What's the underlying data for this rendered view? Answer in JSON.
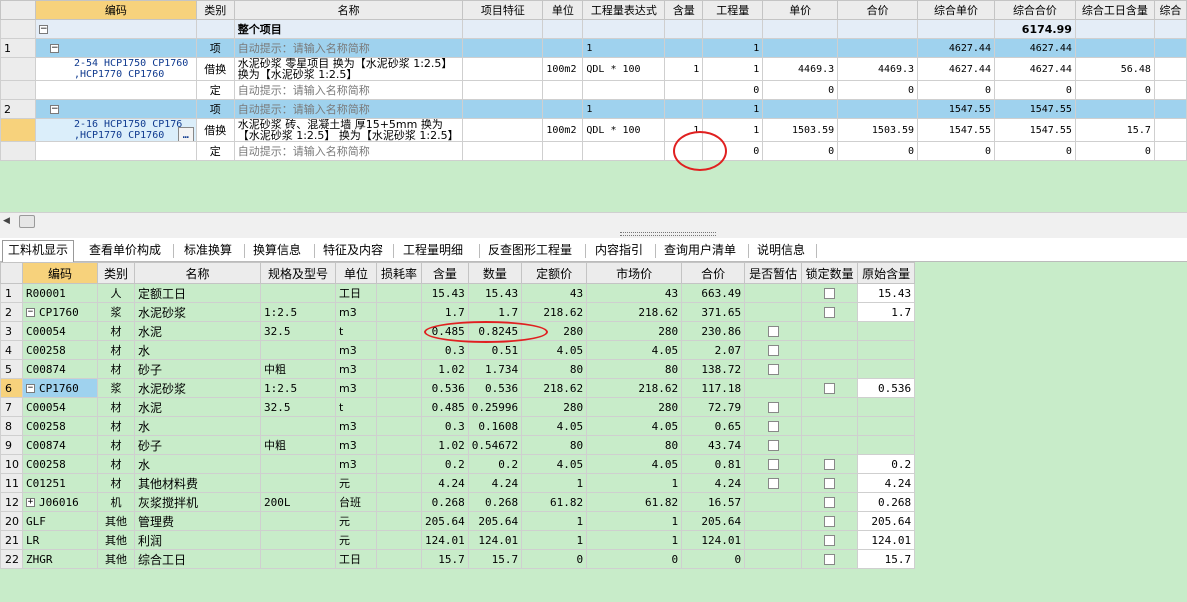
{
  "top": {
    "headers": [
      "编码",
      "类别",
      "名称",
      "项目特征",
      "单位",
      "工程量表达式",
      "含量",
      "工程量",
      "单价",
      "合价",
      "综合单价",
      "综合合价",
      "综合工日含量",
      "综合"
    ],
    "project_row": {
      "name": "整个项目",
      "total": "6174.99"
    },
    "rows": [
      {
        "num": "1",
        "type": "项",
        "name": "自动提示：请输入名称简称",
        "expr": "1",
        "qty": "1",
        "cunit": "4627.44",
        "ctotal": "4627.44"
      },
      {
        "code": "2-54 HCP1750 CP1760 ,HCP1770 CP1760",
        "type": "借换",
        "name": "水泥砂浆 零星项目  换为【水泥砂浆 1:2.5】 换为【水泥砂浆 1:2.5】",
        "unit": "100m2",
        "expr": "QDL * 100",
        "content": "1",
        "qty": "1",
        "price": "4469.3",
        "total": "4469.3",
        "cunit": "4627.44",
        "ctotal": "4627.44",
        "labor": "56.48"
      },
      {
        "type": "定",
        "name": "自动提示：请输入名称简称",
        "qty": "0",
        "price": "0",
        "total": "0",
        "cunit": "0",
        "ctotal": "0",
        "labor": "0"
      },
      {
        "num": "2",
        "type": "项",
        "name": "自动提示：请输入名称简称",
        "expr": "1",
        "qty": "1",
        "cunit": "1547.55",
        "ctotal": "1547.55"
      },
      {
        "code": "2-16 HCP1750 CP176 ,HCP1770 CP1760",
        "type": "借换",
        "name": "水泥砂浆 砖、混凝土墙 厚15+5mm  换为【水泥砂浆 1:2.5】 换为【水泥砂浆 1:2.5】",
        "unit": "100m2",
        "expr": "QDL * 100",
        "content": "1",
        "qty": "1",
        "price": "1503.59",
        "total": "1503.59",
        "cunit": "1547.55",
        "ctotal": "1547.55",
        "labor": "15.7"
      },
      {
        "type": "定",
        "name": "自动提示：请输入名称简称",
        "qty": "0",
        "price": "0",
        "total": "0",
        "cunit": "0",
        "ctotal": "0",
        "labor": "0"
      }
    ]
  },
  "tabs": [
    "工料机显示",
    "查看单价构成",
    "标准换算",
    "换算信息",
    "特征及内容",
    "工程量明细",
    "反查图形工程量",
    "内容指引",
    "查询用户清单",
    "说明信息"
  ],
  "bottom": {
    "headers": [
      "编码",
      "类别",
      "名称",
      "规格及型号",
      "单位",
      "损耗率",
      "含量",
      "数量",
      "定额价",
      "市场价",
      "合价",
      "是否暂估",
      "锁定数量",
      "原始含量"
    ],
    "rows": [
      {
        "n": "1",
        "code": "R00001",
        "type": "人",
        "name": "定额工日",
        "spec": "",
        "unit": "工日",
        "content": "15.43",
        "qty": "15.43",
        "dprice": "43",
        "mprice": "43",
        "total": "663.49",
        "orig": "15.43"
      },
      {
        "n": "2",
        "code": "CP1760",
        "type": "浆",
        "name": "水泥砂浆",
        "spec": "1:2.5",
        "unit": "m3",
        "content": "1.7",
        "qty": "1.7",
        "dprice": "218.62",
        "mprice": "218.62",
        "total": "371.65",
        "orig": "1.7"
      },
      {
        "n": "3",
        "code": "C00054",
        "type": "材",
        "name": "水泥",
        "spec": "32.5",
        "unit": "t",
        "content": "0.485",
        "qty": "0.8245",
        "dprice": "280",
        "mprice": "280",
        "total": "230.86",
        "orig": ""
      },
      {
        "n": "4",
        "code": "C00258",
        "type": "材",
        "name": "水",
        "spec": "",
        "unit": "m3",
        "content": "0.3",
        "qty": "0.51",
        "dprice": "4.05",
        "mprice": "4.05",
        "total": "2.07",
        "orig": ""
      },
      {
        "n": "5",
        "code": "C00874",
        "type": "材",
        "name": "砂子",
        "spec": "中粗",
        "unit": "m3",
        "content": "1.02",
        "qty": "1.734",
        "dprice": "80",
        "mprice": "80",
        "total": "138.72",
        "orig": ""
      },
      {
        "n": "6",
        "code": "CP1760",
        "type": "浆",
        "name": "水泥砂浆",
        "spec": "1:2.5",
        "unit": "m3",
        "content": "0.536",
        "qty": "0.536",
        "dprice": "218.62",
        "mprice": "218.62",
        "total": "117.18",
        "orig": "0.536"
      },
      {
        "n": "7",
        "code": "C00054",
        "type": "材",
        "name": "水泥",
        "spec": "32.5",
        "unit": "t",
        "content": "0.485",
        "qty": "0.25996",
        "dprice": "280",
        "mprice": "280",
        "total": "72.79",
        "orig": ""
      },
      {
        "n": "8",
        "code": "C00258",
        "type": "材",
        "name": "水",
        "spec": "",
        "unit": "m3",
        "content": "0.3",
        "qty": "0.1608",
        "dprice": "4.05",
        "mprice": "4.05",
        "total": "0.65",
        "orig": ""
      },
      {
        "n": "9",
        "code": "C00874",
        "type": "材",
        "name": "砂子",
        "spec": "中粗",
        "unit": "m3",
        "content": "1.02",
        "qty": "0.54672",
        "dprice": "80",
        "mprice": "80",
        "total": "43.74",
        "orig": ""
      },
      {
        "n": "10",
        "code": "C00258",
        "type": "材",
        "name": "水",
        "spec": "",
        "unit": "m3",
        "content": "0.2",
        "qty": "0.2",
        "dprice": "4.05",
        "mprice": "4.05",
        "total": "0.81",
        "orig": "0.2"
      },
      {
        "n": "11",
        "code": "C01251",
        "type": "材",
        "name": "其他材料费",
        "spec": "",
        "unit": "元",
        "content": "4.24",
        "qty": "4.24",
        "dprice": "1",
        "mprice": "1",
        "total": "4.24",
        "orig": "4.24"
      },
      {
        "n": "12",
        "code": "J06016",
        "type": "机",
        "name": "灰浆搅拌机",
        "spec": "200L",
        "unit": "台班",
        "content": "0.268",
        "qty": "0.268",
        "dprice": "61.82",
        "mprice": "61.82",
        "total": "16.57",
        "orig": "0.268"
      },
      {
        "n": "20",
        "code": "GLF",
        "type": "其他",
        "name": "管理费",
        "spec": "",
        "unit": "元",
        "content": "205.64",
        "qty": "205.64",
        "dprice": "1",
        "mprice": "1",
        "total": "205.64",
        "orig": "205.64"
      },
      {
        "n": "21",
        "code": "LR",
        "type": "其他",
        "name": "利润",
        "spec": "",
        "unit": "元",
        "content": "124.01",
        "qty": "124.01",
        "dprice": "1",
        "mprice": "1",
        "total": "124.01",
        "orig": "124.01"
      },
      {
        "n": "22",
        "code": "ZHGR",
        "type": "其他",
        "name": "综合工日",
        "spec": "",
        "unit": "工日",
        "content": "15.7",
        "qty": "15.7",
        "dprice": "0",
        "mprice": "0",
        "total": "0",
        "orig": "15.7"
      }
    ]
  }
}
